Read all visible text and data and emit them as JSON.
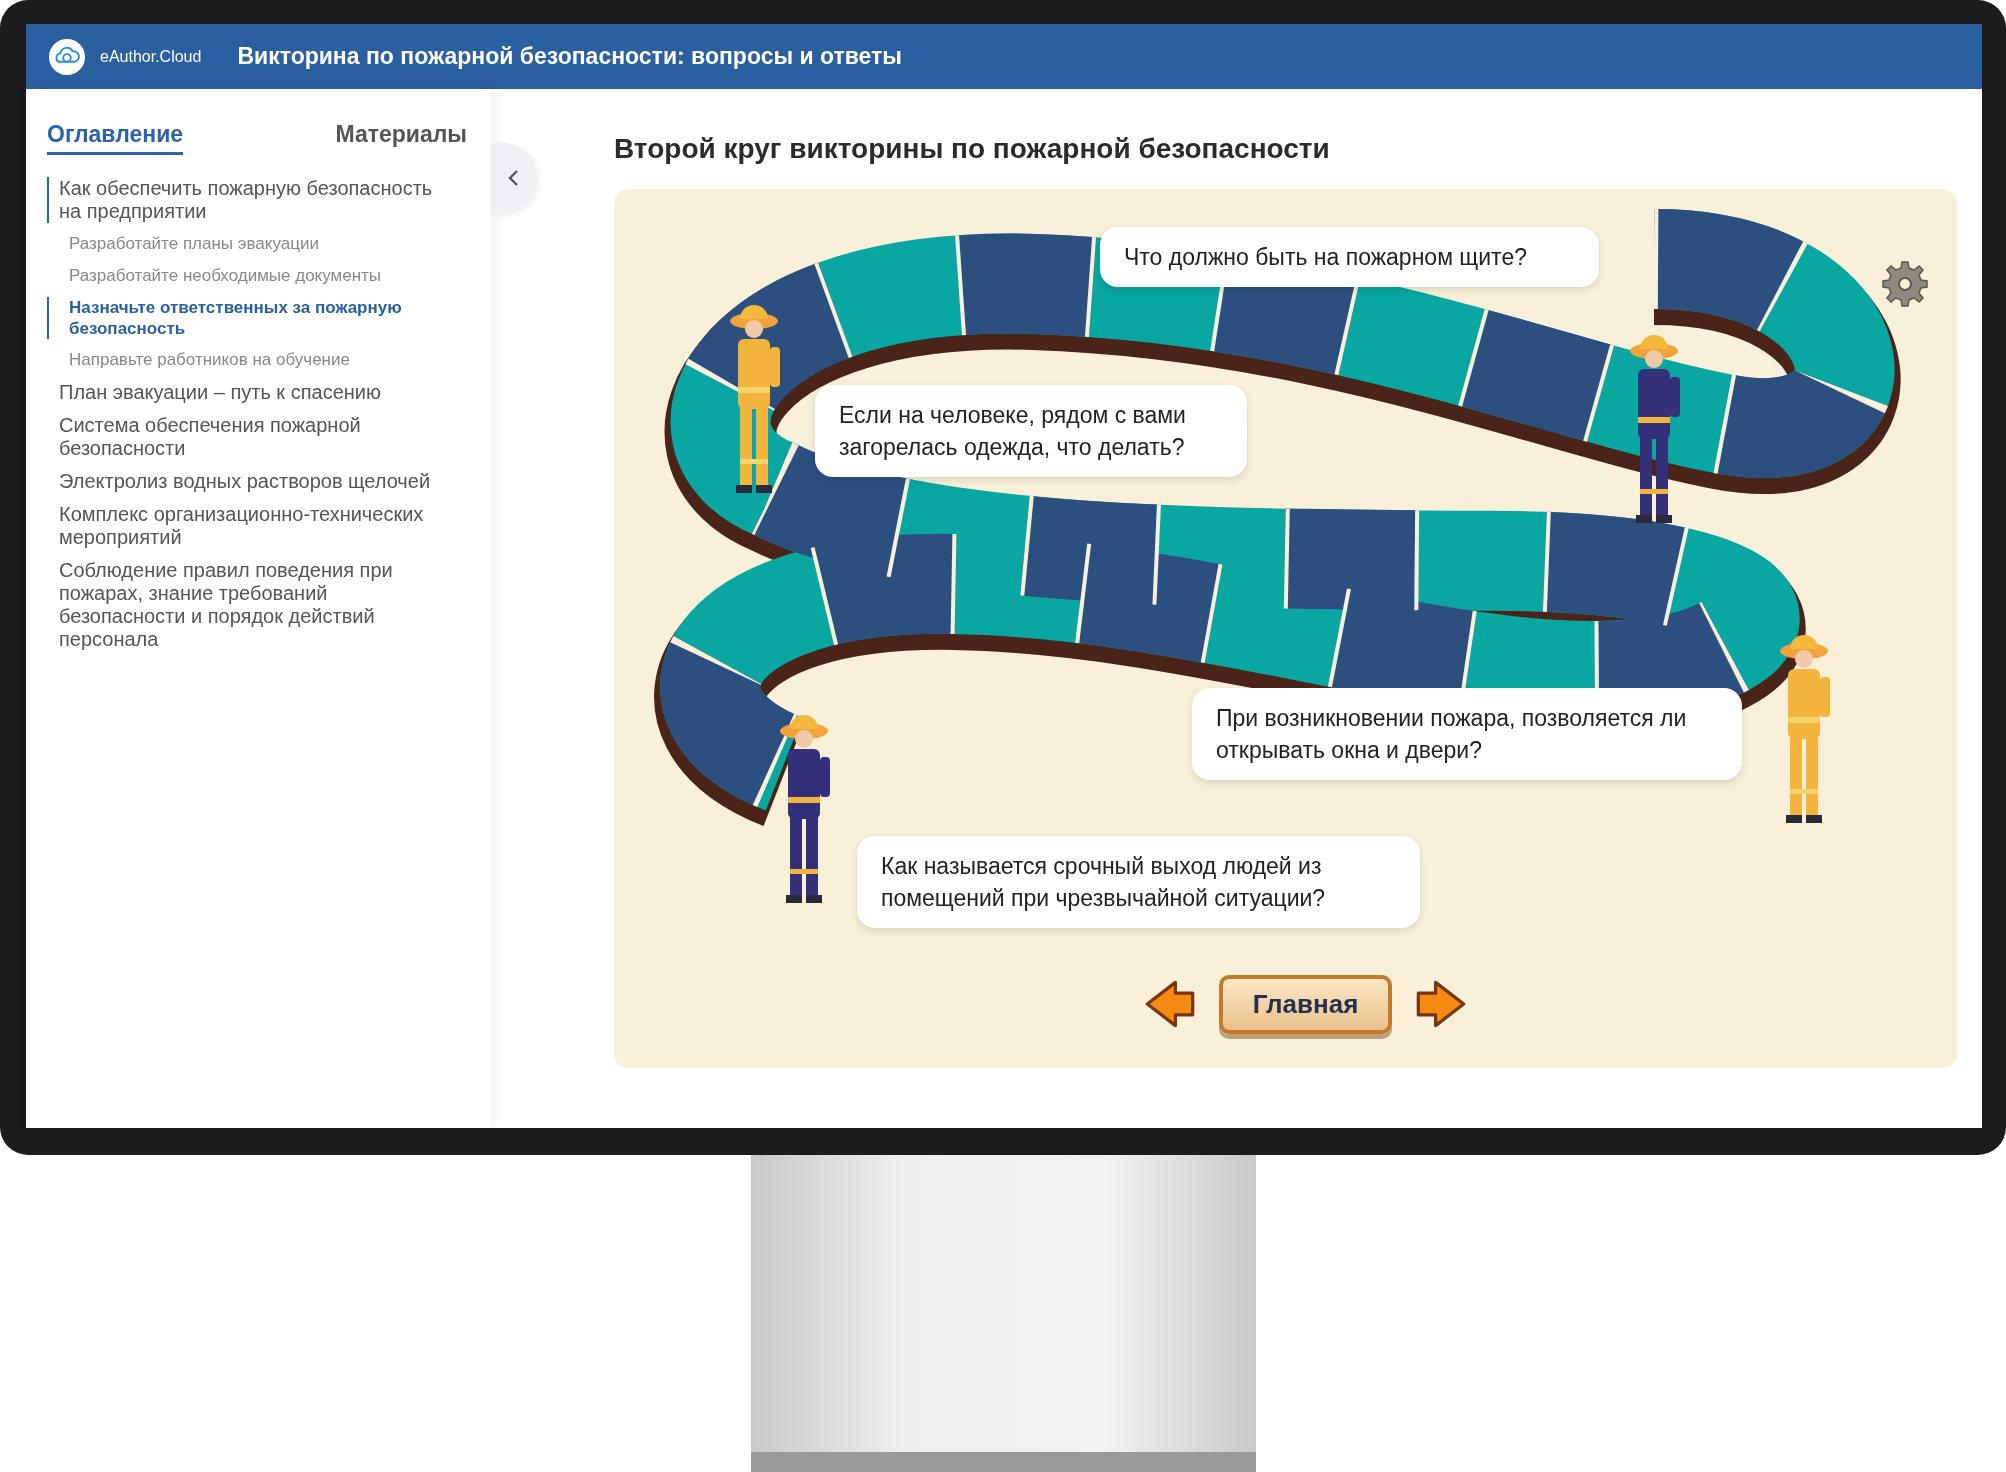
{
  "header": {
    "brand": "eAuthor.Cloud",
    "title": "Викторина по пожарной безопасности: вопросы и ответы"
  },
  "sidebar": {
    "tabs": [
      {
        "label": "Оглавление",
        "selected": true
      },
      {
        "label": "Материалы",
        "selected": false
      }
    ],
    "items": [
      {
        "label": "Как обеспечить пожарную безопасность на предприятии",
        "active": true,
        "children": [
          {
            "label": "Разработайте планы эвакуации",
            "selected": false
          },
          {
            "label": "Разработайте необходимые документы",
            "selected": false
          },
          {
            "label": "Назначьте ответственных за пожарную безопасность",
            "selected": true
          },
          {
            "label": "Направьте работников на обучение",
            "selected": false
          }
        ]
      },
      {
        "label": "План эвакуации – путь к спасению",
        "active": false
      },
      {
        "label": "Система обеспечения пожарной безопасности",
        "active": false
      },
      {
        "label": "Электролиз водных растворов щелочей",
        "active": false
      },
      {
        "label": "Комплекс организационно-технических мероприятий",
        "active": false
      },
      {
        "label": "Соблюдение правил поведения при пожарах, знание требований безопасности и порядок действий персонала",
        "active": false
      }
    ]
  },
  "content": {
    "title": "Второй круг викторины по пожарной безопасности",
    "questions": [
      "Что должно быть на пожарном щите?",
      "Если на человеке, рядом с вами загорелась одежда, что делать?",
      "При возникновении пожара, позволяется ли открывать окна и двери?",
      "Как называется срочный выход людей из помещений при чрезвычайной ситуации?"
    ],
    "home_button": "Главная"
  }
}
